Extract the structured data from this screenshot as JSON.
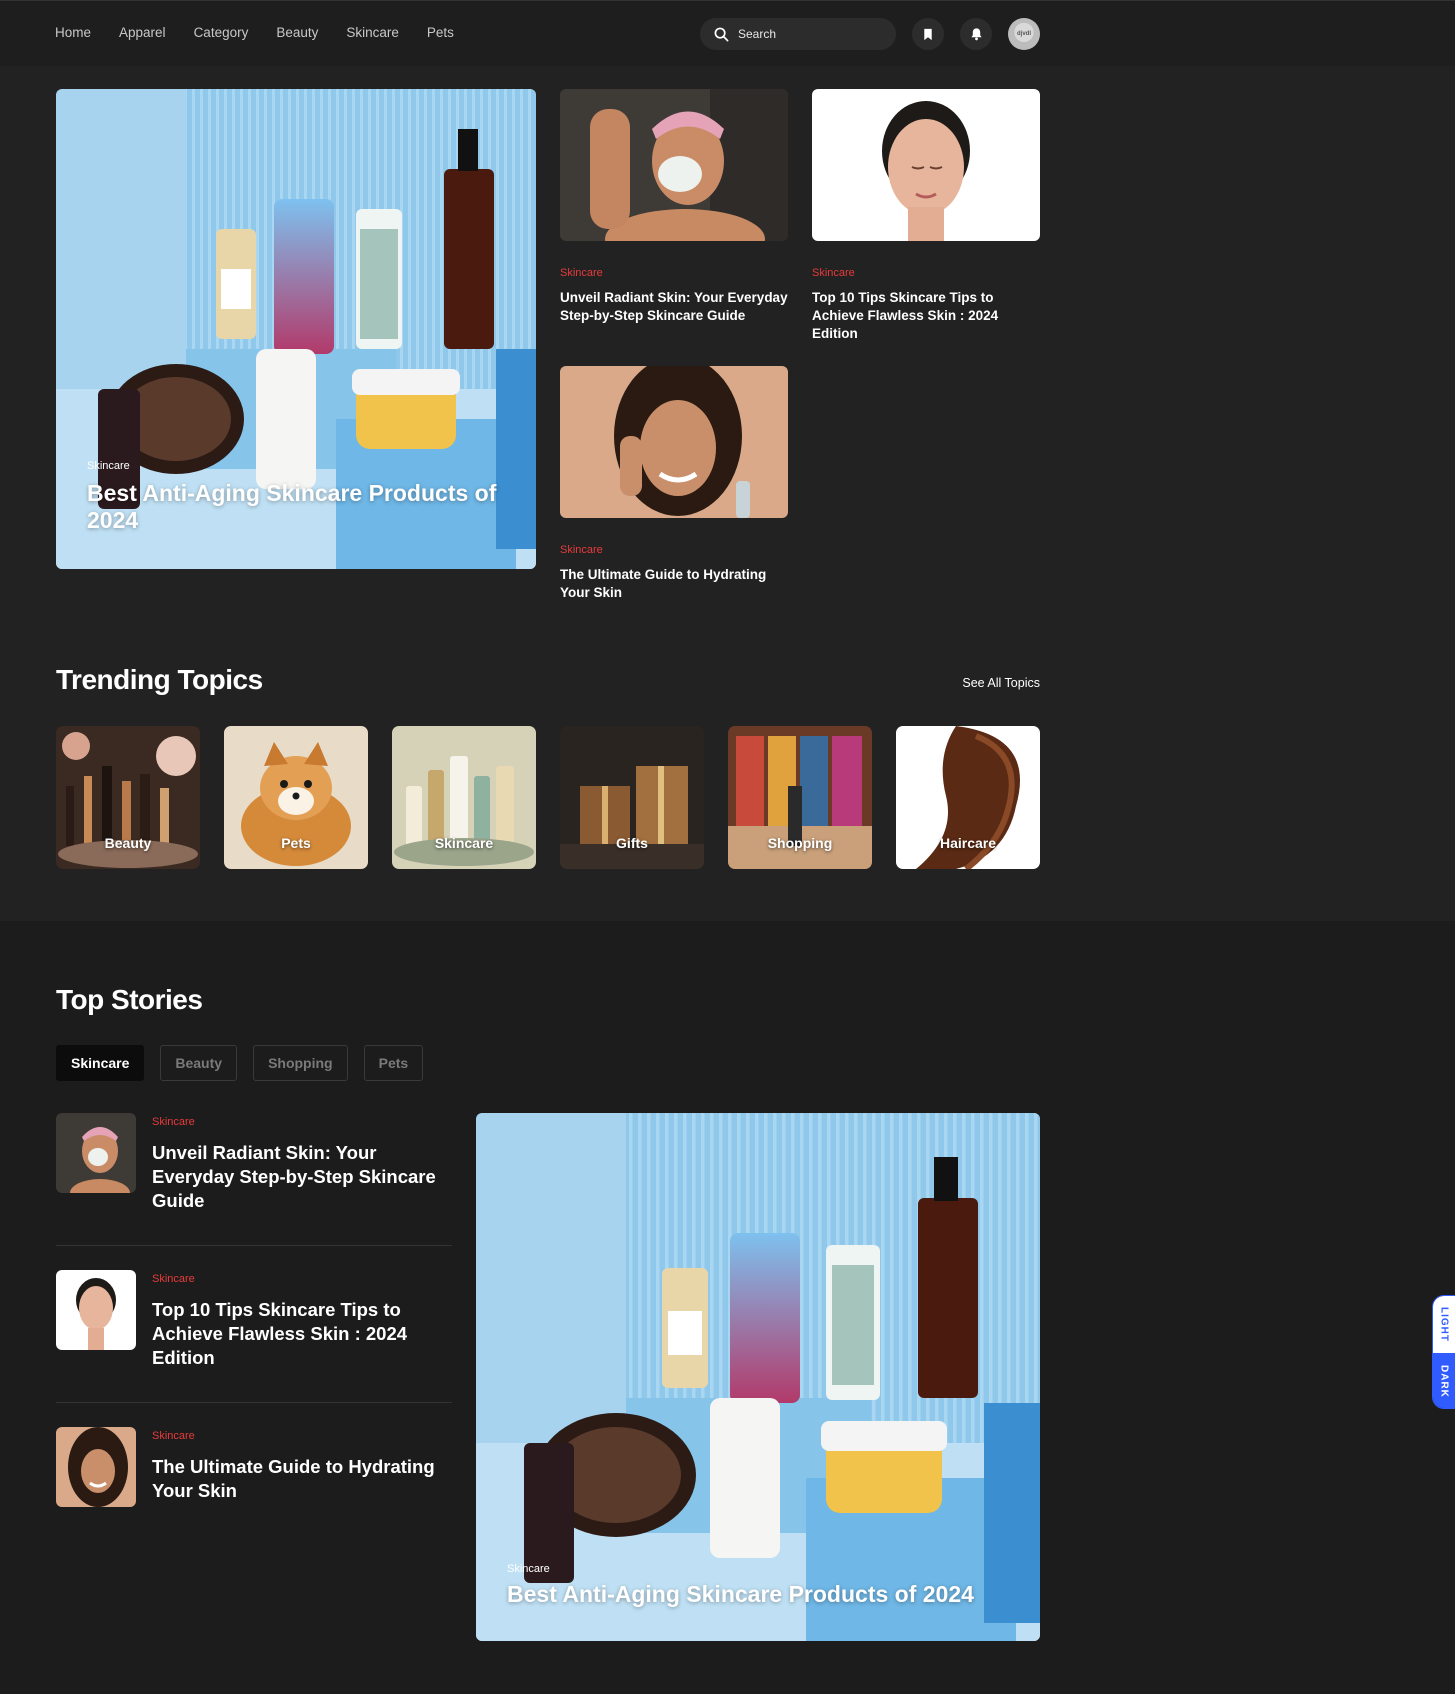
{
  "nav": {
    "items": [
      {
        "label": "Home"
      },
      {
        "label": "Apparel"
      },
      {
        "label": "Category"
      },
      {
        "label": "Beauty"
      },
      {
        "label": "Skincare"
      },
      {
        "label": "Pets"
      }
    ],
    "search_placeholder": "Search",
    "icons": [
      "search-icon",
      "bookmark-icon",
      "bell-icon"
    ],
    "avatar_text": "djvdl"
  },
  "hero": {
    "featured": {
      "category": "Skincare",
      "title": "Best Anti-Aging Skincare Products of 2024"
    },
    "articles": [
      {
        "category": "Skincare",
        "title": "Unveil Radiant Skin: Your Everyday Step-by-Step Skincare Guide"
      },
      {
        "category": "Skincare",
        "title": "Top 10 Tips Skincare Tips to Achieve Flawless Skin : 2024 Edition"
      },
      {
        "category": "Skincare",
        "title": "The Ultimate Guide to Hydrating Your Skin"
      }
    ]
  },
  "trending": {
    "heading": "Trending Topics",
    "see_all": "See All Topics",
    "topics": [
      {
        "label": "Beauty"
      },
      {
        "label": "Pets"
      },
      {
        "label": "Skincare"
      },
      {
        "label": "Gifts"
      },
      {
        "label": "Shopping"
      },
      {
        "label": "Haircare"
      }
    ]
  },
  "top_stories": {
    "heading": "Top Stories",
    "tabs": [
      {
        "label": "Skincare",
        "active": true
      },
      {
        "label": "Beauty"
      },
      {
        "label": "Shopping"
      },
      {
        "label": "Pets"
      }
    ],
    "stories": [
      {
        "category": "Skincare",
        "title": "Unveil Radiant Skin: Your Everyday Step-by-Step Skincare Guide"
      },
      {
        "category": "Skincare",
        "title": "Top 10 Tips Skincare Tips to Achieve Flawless Skin : 2024 Edition"
      },
      {
        "category": "Skincare",
        "title": "The Ultimate Guide to Hydrating Your Skin"
      }
    ],
    "featured": {
      "category": "Skincare",
      "title": "Best Anti-Aging Skincare Products of 2024"
    }
  },
  "theme_toggle": {
    "light_label": "LIGHT",
    "dark_label": "DARK"
  },
  "colors": {
    "accent_red": "#e63b3b",
    "toggle_blue": "#2f5bff",
    "background": "#222222"
  }
}
